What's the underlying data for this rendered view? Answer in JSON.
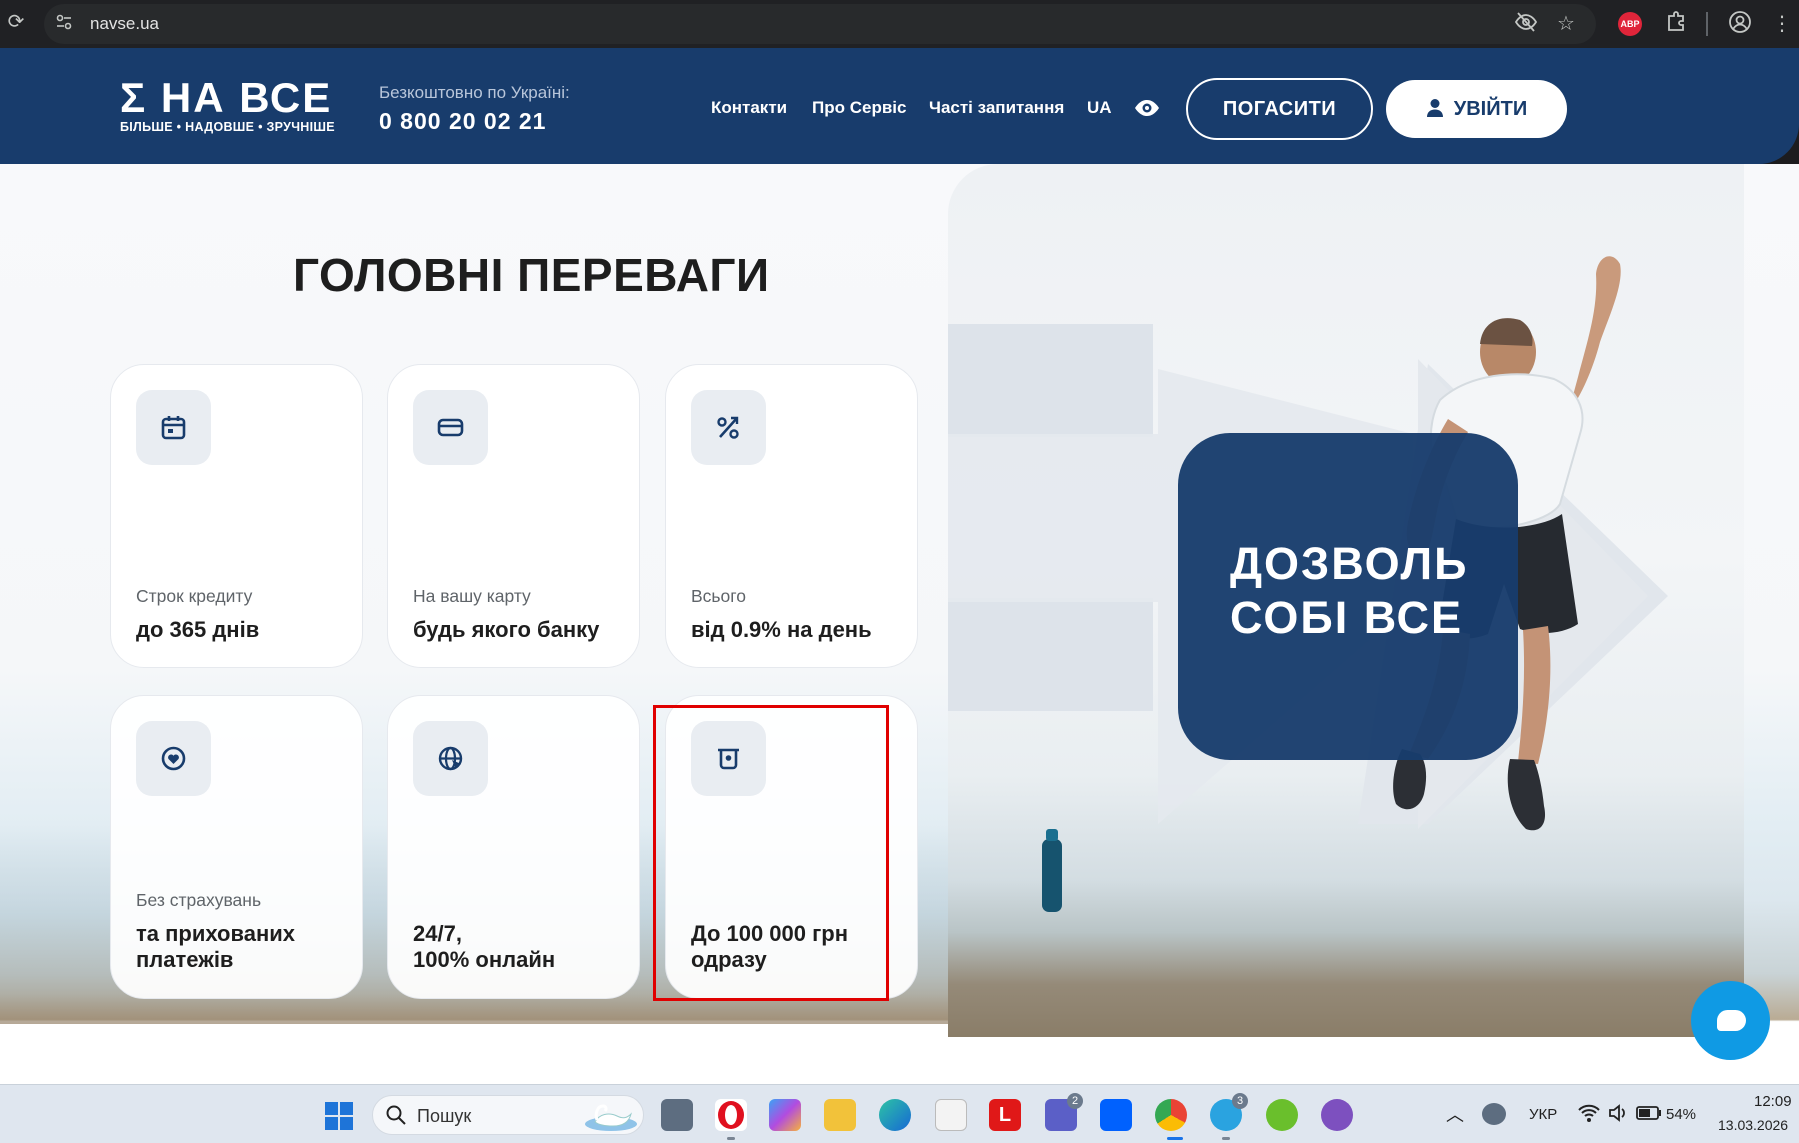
{
  "browser": {
    "url": "navse.ua",
    "extension_badge": "ABP",
    "icons": [
      "reload-icon",
      "site-info-icon",
      "eye-off-icon",
      "star-icon",
      "adblock-icon",
      "extensions-icon",
      "profile-icon",
      "menu-icon"
    ]
  },
  "header": {
    "logo_mark": "Ʃ НА ВСЕ",
    "logo_tagline": "БІЛЬШЕ • НАДОВШЕ • ЗРУЧНІШЕ",
    "hotline_label": "Безкоштовно по Україні:",
    "hotline_phone": "0 800 20 02 21",
    "nav": [
      "Контакти",
      "Про Сервіс",
      "Часті запитання",
      "UA"
    ],
    "pay_label": "ПОГАСИТИ",
    "login_label": "УВІЙТИ",
    "brand_color": "#183c6c"
  },
  "main": {
    "section_title": "ГОЛОВНІ ПЕРЕВАГИ",
    "features": [
      {
        "icon": "calendar-icon",
        "label": "Строк кредиту",
        "value": "до 365 днів"
      },
      {
        "icon": "card-icon",
        "label": "На вашу карту",
        "value": "будь якого банку"
      },
      {
        "icon": "percent-icon",
        "label": "Всього",
        "value": "від 0.9% на день"
      },
      {
        "icon": "shield-heart-icon",
        "label": "Без страхувань",
        "value": "та прихованих\nплатежів"
      },
      {
        "icon": "globe-icon",
        "label": "",
        "value": "24/7,\n100% онлайн"
      },
      {
        "icon": "atm-icon",
        "label": "",
        "value": "До 100 000 грн\nодразу"
      }
    ],
    "hero_text": "ДОЗВОЛЬ\nСОБІ ВСЕ",
    "highlight_color": "#e00000",
    "chat_color": "#0f9ae4"
  },
  "taskbar": {
    "search_placeholder": "Пошук",
    "apps": [
      "task-view-icon",
      "opera-icon",
      "copilot-icon",
      "file-explorer-icon",
      "edge-icon",
      "store-icon",
      "l-app-icon",
      "teams-icon",
      "dropbox-icon",
      "chrome-icon",
      "telegram-icon",
      "utorrent-icon",
      "viber-icon"
    ],
    "teams_badge": "2",
    "telegram_badge": "3",
    "language": "УКР",
    "battery": "54%",
    "time": "12:09",
    "date": "13.03.2026"
  }
}
